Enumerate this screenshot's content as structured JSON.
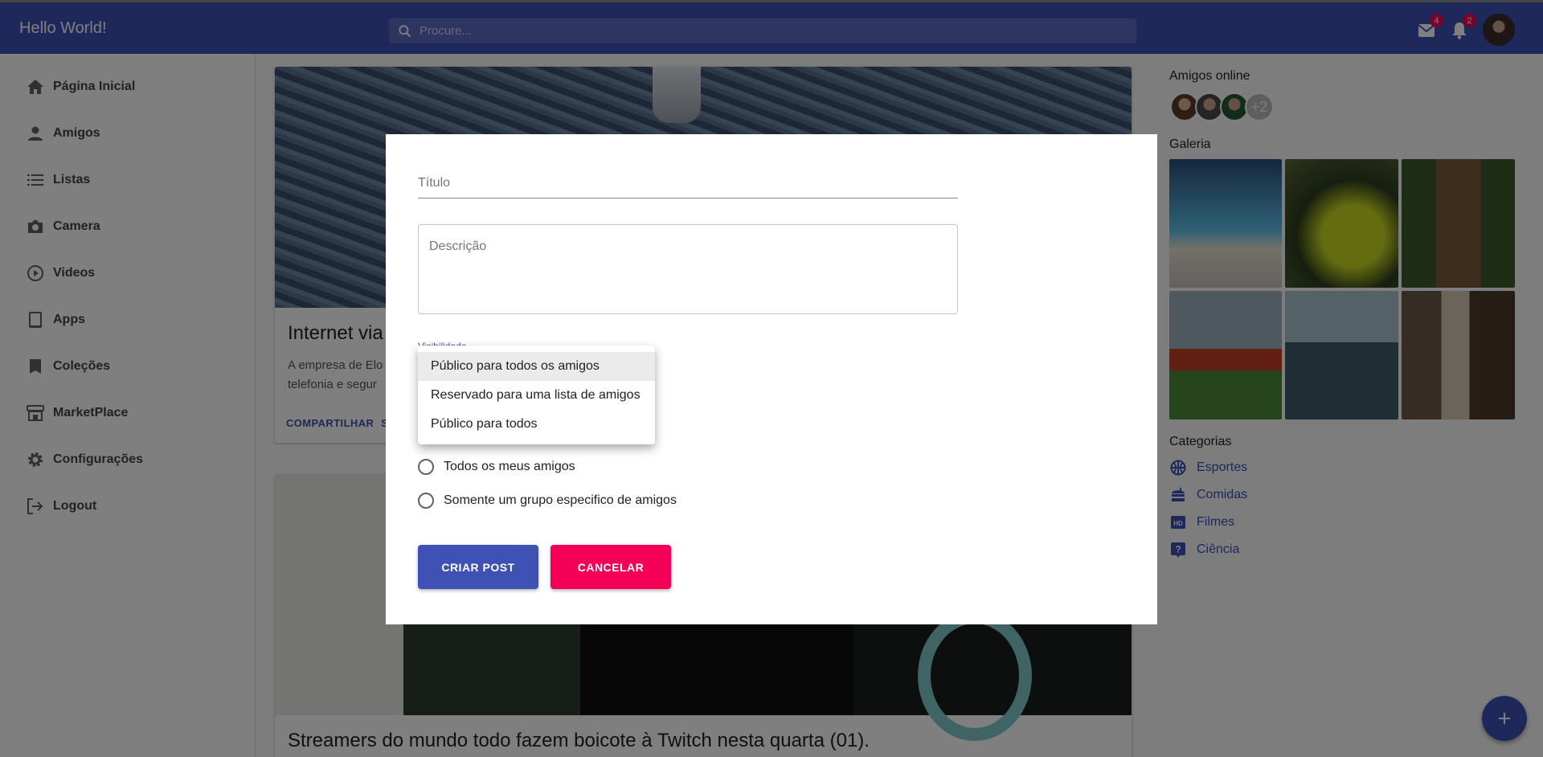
{
  "appbar": {
    "title": "Hello World!",
    "search_placeholder": "Procure...",
    "mail_badge": "4",
    "notifications_badge": "2"
  },
  "sidebar": {
    "items": [
      {
        "label": "Página Inicial",
        "icon": "home-icon"
      },
      {
        "label": "Amigos",
        "icon": "person-icon"
      },
      {
        "label": "Listas",
        "icon": "list-icon"
      },
      {
        "label": "Camera",
        "icon": "camera-icon"
      },
      {
        "label": "Videos",
        "icon": "play-circle-icon"
      },
      {
        "label": "Apps",
        "icon": "tablet-icon"
      },
      {
        "label": "Coleções",
        "icon": "bookmark-icon"
      },
      {
        "label": "MarketPlace",
        "icon": "store-icon"
      },
      {
        "label": "Configurações",
        "icon": "gear-icon"
      },
      {
        "label": "Logout",
        "icon": "logout-icon"
      }
    ]
  },
  "feed": {
    "post1": {
      "title": "Internet via",
      "text_line1": "A empresa de Elo",
      "text_line2": "telefonia e segur",
      "share_label": "COMPARTILHAR",
      "second_action": "S"
    },
    "post2": {
      "title": "Streamers do mundo todo fazem boicote à Twitch nesta quarta (01)."
    }
  },
  "right": {
    "friends_heading": "Amigos online",
    "friends_more": "+2",
    "gallery_heading": "Galeria",
    "categories_heading": "Categorias",
    "categories": [
      {
        "label": "Esportes",
        "icon": "sports-icon"
      },
      {
        "label": "Comidas",
        "icon": "food-icon"
      },
      {
        "label": "Filmes",
        "icon": "hd-icon"
      },
      {
        "label": "Ciência",
        "icon": "question-icon"
      }
    ]
  },
  "dialog": {
    "title_placeholder": "Título",
    "description_placeholder": "Descrição",
    "visibility_label": "Visibilidade",
    "visibility_options": [
      "Público para todos os amigos",
      "Reservado para uma lista de amigos",
      "Público para todos"
    ],
    "radio_all_friends": "Todos os meus amigos",
    "radio_group": "Somente um grupo especifico de amigos",
    "create_button": "CRIAR POST",
    "cancel_button": "CANCELAR"
  },
  "colors": {
    "primary": "#3f51b5",
    "secondary": "#f50057"
  }
}
